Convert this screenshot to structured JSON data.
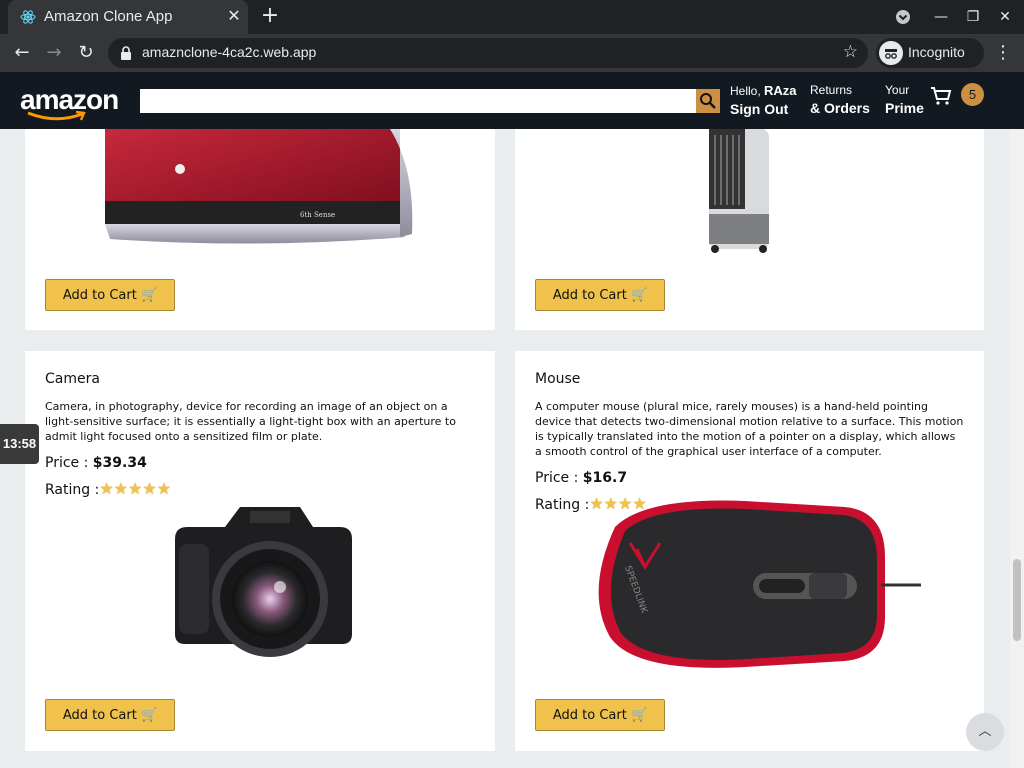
{
  "browser": {
    "tab_title": "Amazon Clone App",
    "url": "amaznclone-4ca2c.web.app",
    "profile_label": "Incognito"
  },
  "header": {
    "logo_text": "amazon",
    "search_placeholder": "",
    "greeting_prefix": "Hello,",
    "user_name": "RAza",
    "sign_out": "Sign Out",
    "returns_line1": "Returns",
    "returns_line2": "& Orders",
    "prime_line1": "Your",
    "prime_line2": "Prime",
    "cart_count": "5"
  },
  "products": [
    {
      "add_to_cart": "Add to Cart 🛒",
      "image": "air-conditioner"
    },
    {
      "add_to_cart": "Add to Cart 🛒",
      "image": "air-cooler"
    },
    {
      "title": "Camera",
      "description": "Camera, in photography, device for recording an image of an object on a light-sensitive surface; it is essentially a light-tight box with an aperture to admit light focused onto a sensitized film or plate.",
      "price_label": "Price :",
      "price": "$39.34",
      "rating_label": "Rating :",
      "rating": 5,
      "add_to_cart": "Add to Cart 🛒",
      "image": "camera"
    },
    {
      "title": "Mouse",
      "description": "A computer mouse (plural mice, rarely mouses) is a hand-held pointing device that detects two-dimensional motion relative to a surface. This motion is typically translated into the motion of a pointer on a display, which allows a smooth control of the graphical user interface of a computer.",
      "price_label": "Price :",
      "price": "$16.7",
      "rating_label": "Rating :",
      "rating": 4,
      "add_to_cart": "Add to Cart 🛒",
      "image": "mouse"
    }
  ],
  "clock": "13:58",
  "colors": {
    "header_bg": "#131921",
    "button_bg": "#f0c14b",
    "accent": "#cd9042",
    "page_bg": "#eaeded"
  }
}
